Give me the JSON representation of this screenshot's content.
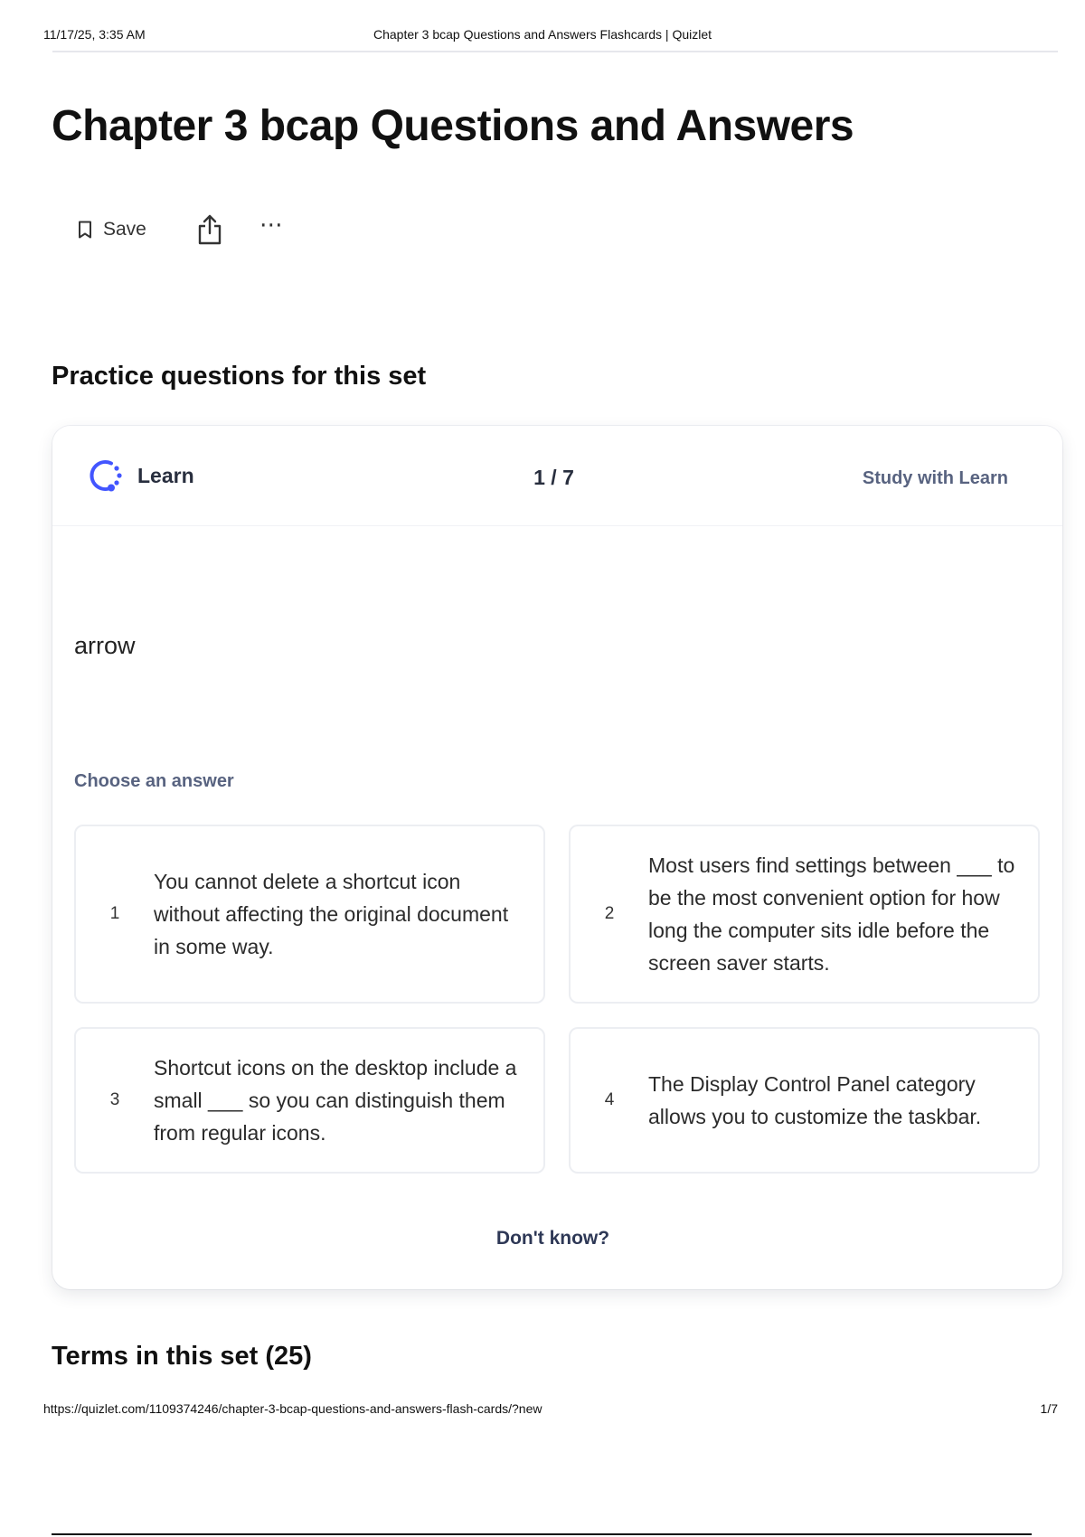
{
  "print_header": {
    "datetime": "11/17/25, 3:35 AM",
    "document_title": "Chapter 3 bcap Questions and Answers Flashcards | Quizlet"
  },
  "page": {
    "title": "Chapter 3 bcap Questions and Answers"
  },
  "toolbar": {
    "save_label": "Save",
    "save_icon": "bookmark-icon",
    "share_icon": "share-icon",
    "more_label": "⋯",
    "more_icon": "more-options-icon"
  },
  "practice": {
    "heading": "Practice questions for this set",
    "mode_label": "Learn",
    "mode_icon": "learn-icon",
    "progress": "1 / 7",
    "study_link": "Study with Learn",
    "term": "arrow",
    "choose_label": "Choose an answer",
    "options": [
      {
        "number": "1",
        "text": "You cannot delete a shortcut icon without affecting the original document in some way."
      },
      {
        "number": "2",
        "text": "Most users find settings between ___ to be the most convenient option for how long the computer sits idle before the screen saver starts."
      },
      {
        "number": "3",
        "text": "Shortcut icons on the desktop include a small ___ so you can distinguish them from regular icons."
      },
      {
        "number": "4",
        "text": "The Display Control Panel category allows you to customize the taskbar."
      }
    ],
    "dont_know": "Don't know?"
  },
  "terms": {
    "heading": "Terms in this set (25)"
  },
  "print_footer": {
    "url": "https://quizlet.com/1109374246/chapter-3-bcap-questions-and-answers-flash-cards/?new",
    "page_number": "1/7"
  },
  "colors": {
    "accent_blue": "#4255ff",
    "link_gray": "#586380",
    "card_border": "#eceef2"
  }
}
